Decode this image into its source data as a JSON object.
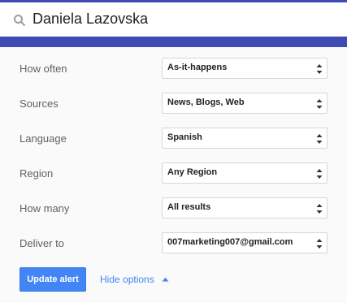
{
  "search": {
    "query": "Daniela Lazovska",
    "icon": "search-icon"
  },
  "options": [
    {
      "label": "How often",
      "value": "As-it-happens"
    },
    {
      "label": "Sources",
      "value": "News, Blogs, Web"
    },
    {
      "label": "Language",
      "value": "Spanish"
    },
    {
      "label": "Region",
      "value": "Any Region"
    },
    {
      "label": "How many",
      "value": "All results"
    },
    {
      "label": "Deliver to",
      "value": "007marketing007@gmail.com"
    }
  ],
  "actions": {
    "update_label": "Update alert",
    "hide_options_label": "Hide options",
    "hide_icon": "chevron-up-icon"
  },
  "colors": {
    "brand_bar": "#3f4bb5",
    "accent": "#4285f4",
    "panel_bg": "#fafafa"
  }
}
